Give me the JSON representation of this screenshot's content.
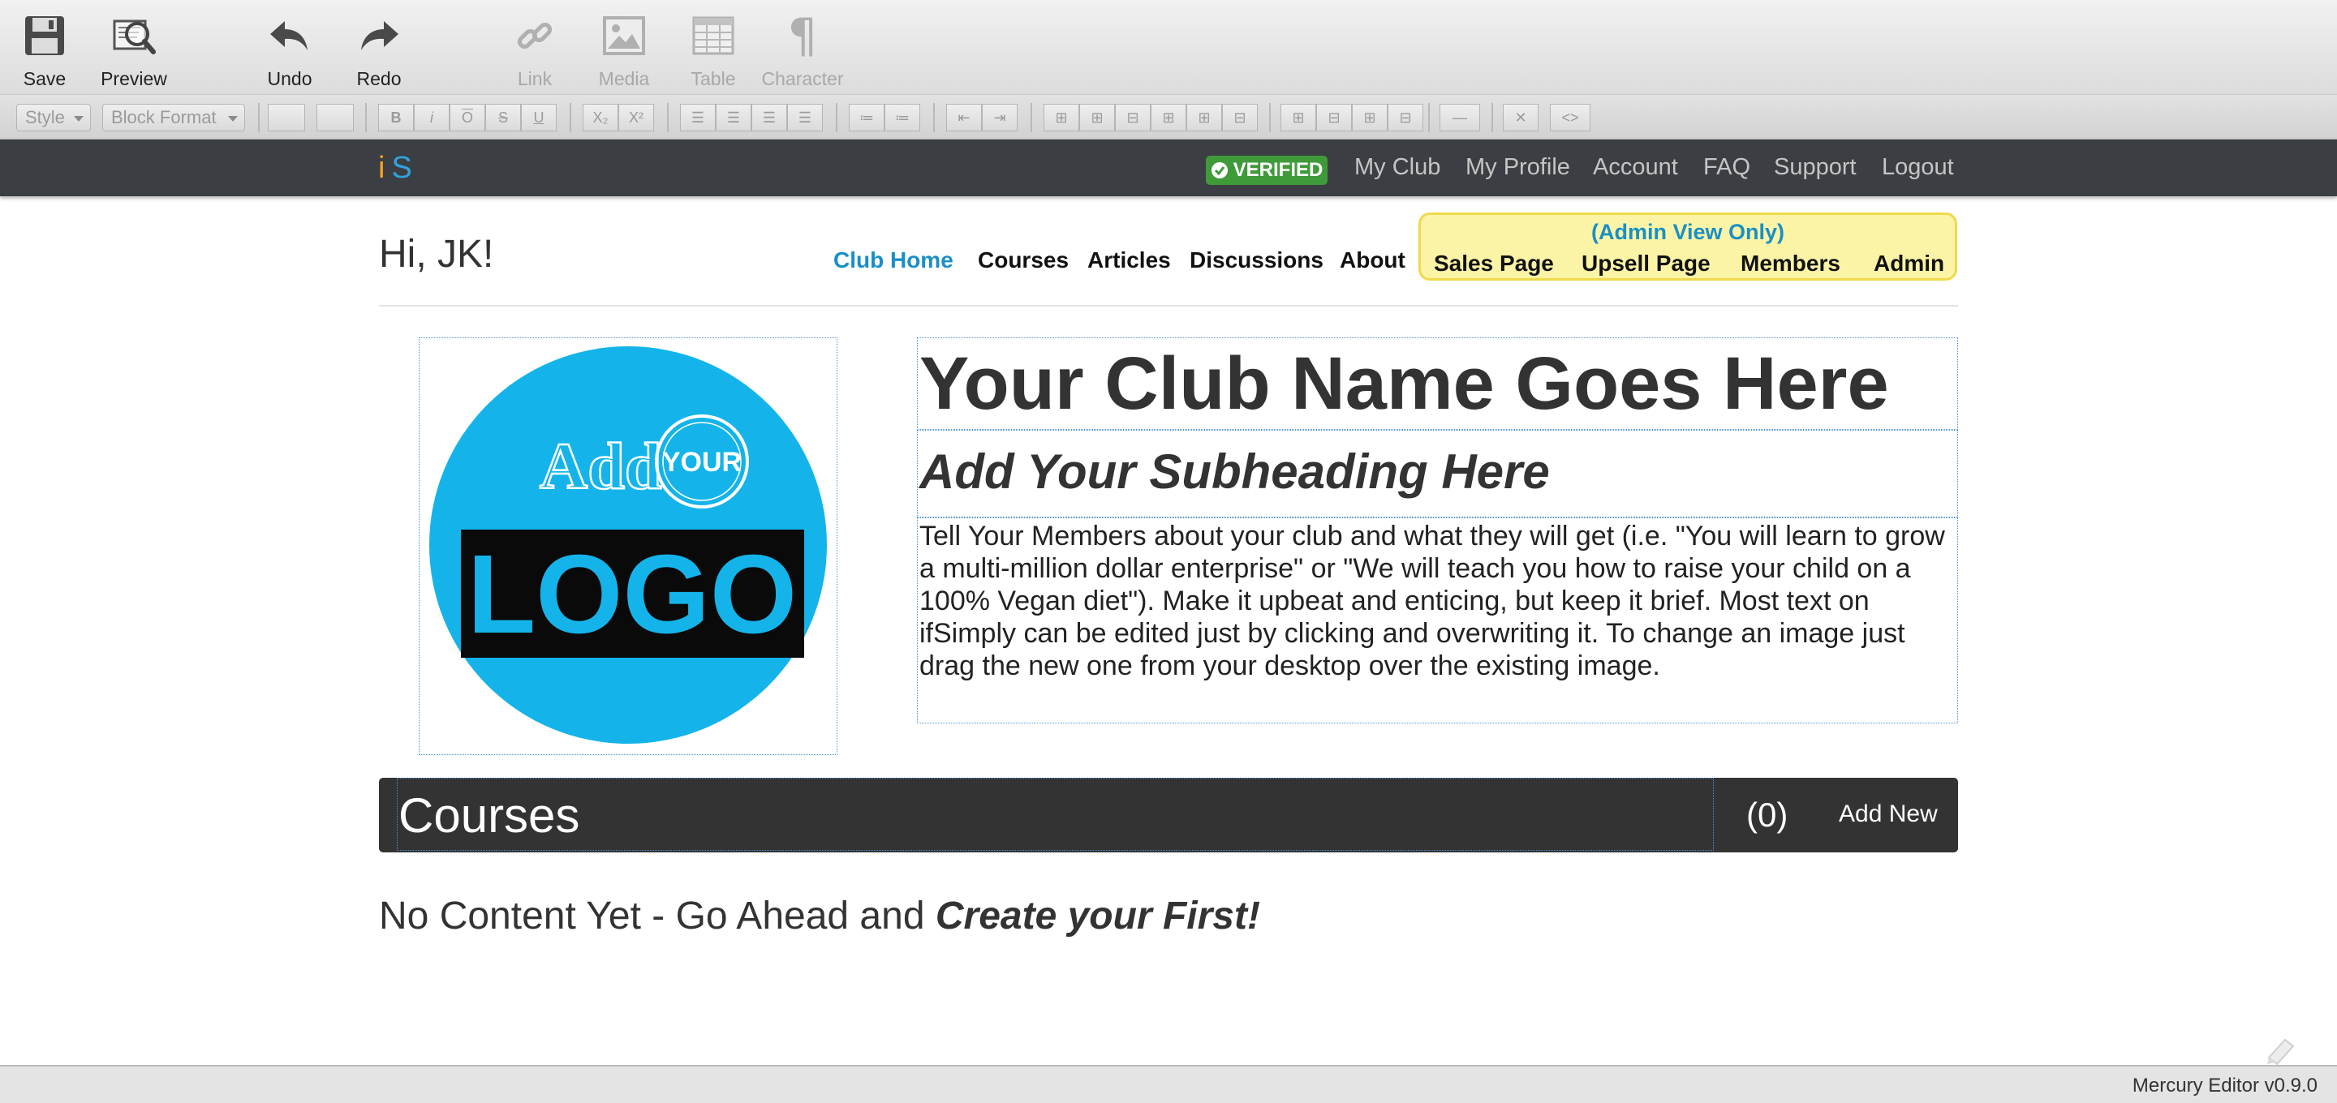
{
  "toolbar": {
    "save": "Save",
    "preview": "Preview",
    "undo": "Undo",
    "redo": "Redo",
    "link": "Link",
    "media": "Media",
    "table": "Table",
    "character": "Character"
  },
  "format_toolbar": {
    "style": "Style",
    "block_format": "Block Format",
    "bold": "B",
    "italic": "i",
    "overline": "O",
    "strike": "S",
    "underline": "U",
    "subscript": "X₂",
    "superscript": "X²"
  },
  "site_nav": {
    "brand_i": "i",
    "brand_s": "S",
    "verified": "VERIFIED",
    "links": [
      "My Club",
      "My Profile",
      "Account",
      "FAQ",
      "Support",
      "Logout"
    ]
  },
  "header": {
    "greeting": "Hi, JK!",
    "nav": [
      "Club Home",
      "Courses",
      "Articles",
      "Discussions",
      "About"
    ],
    "admin_title": "(Admin View Only)",
    "admin_links": [
      "Sales Page",
      "Upsell Page",
      "Members",
      "Admin"
    ]
  },
  "hero": {
    "logo_add": "Add",
    "logo_your": "YOUR",
    "logo_logo": "LOGO",
    "title": "Your Club Name Goes Here",
    "subheading": "Add Your Subheading Here",
    "description": "Tell Your Members about your club and what they will get (i.e. \"You will learn to grow a multi-million dollar enterprise\" or \"We will teach you how to raise your child on a 100% Vegan diet\"). Make it upbeat and enticing, but keep it brief. Most text on ifSimply can be edited just by clicking and overwriting it. To change an image just drag the new one from your desktop over the existing image."
  },
  "courses": {
    "title": "Courses",
    "count": "(0)",
    "add_new": "Add New",
    "empty_prefix": "No Content Yet - Go Ahead and ",
    "empty_cta": "Create your First!"
  },
  "status": {
    "text": "Mercury Editor v0.9.0"
  },
  "colors": {
    "nav_bg": "#3b3e42",
    "accent_blue": "#1a8fc6",
    "verified_green": "#3f9a3a",
    "admin_yellow": "#fbf4a6",
    "logo_cyan": "#14b4ea",
    "courses_bar": "#333333"
  }
}
